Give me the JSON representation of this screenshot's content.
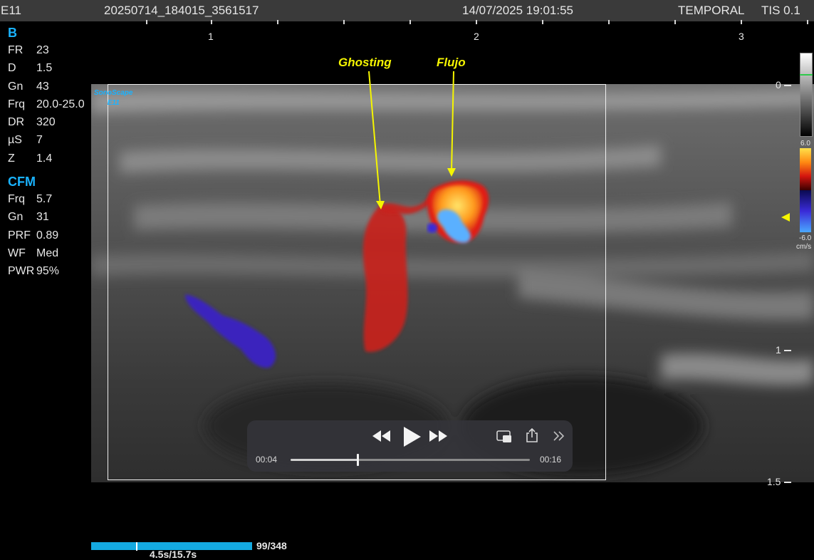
{
  "header": {
    "probe": "E11",
    "study_id": "20250714_184015_3561517",
    "datetime": "14/07/2025 19:01:55",
    "preset": "TEMPORAL",
    "tis": "TIS  0.1"
  },
  "ruler": {
    "labels": [
      "1",
      "2",
      "3"
    ]
  },
  "b_mode": {
    "title": "B",
    "params": [
      {
        "key": "FR",
        "value": "23"
      },
      {
        "key": "D",
        "value": "1.5"
      },
      {
        "key": "Gn",
        "value": "43"
      },
      {
        "key": "Frq",
        "value": "20.0-25.0"
      },
      {
        "key": "DR",
        "value": "320"
      },
      {
        "key": "µS",
        "value": "7"
      },
      {
        "key": "Z",
        "value": "1.4"
      }
    ]
  },
  "cfm_mode": {
    "title": "CFM",
    "params": [
      {
        "key": "Frq",
        "value": "5.7"
      },
      {
        "key": "Gn",
        "value": "31"
      },
      {
        "key": "PRF",
        "value": "0.89"
      },
      {
        "key": "WF",
        "value": "Med"
      },
      {
        "key": "PWR",
        "value": "95%"
      }
    ]
  },
  "logo": {
    "line1": "SonoScape",
    "line2": "E11"
  },
  "annotations": {
    "ghosting": "Ghosting",
    "flujo": "Flujo"
  },
  "depth_labels": [
    "0",
    "1",
    "1.5"
  ],
  "color_scale": {
    "max": "6.0",
    "min": "-6.0",
    "unit": "cm/s"
  },
  "player": {
    "current_time": "00:04",
    "total_time": "00:16",
    "progress": 0.28
  },
  "cine": {
    "frames": "99/348",
    "time": "4.5s/15.7s",
    "progress": 0.28
  },
  "colors": {
    "accent": "#1ab3ff",
    "annotation": "#f5f500",
    "topbar": "#3a3a3a"
  }
}
